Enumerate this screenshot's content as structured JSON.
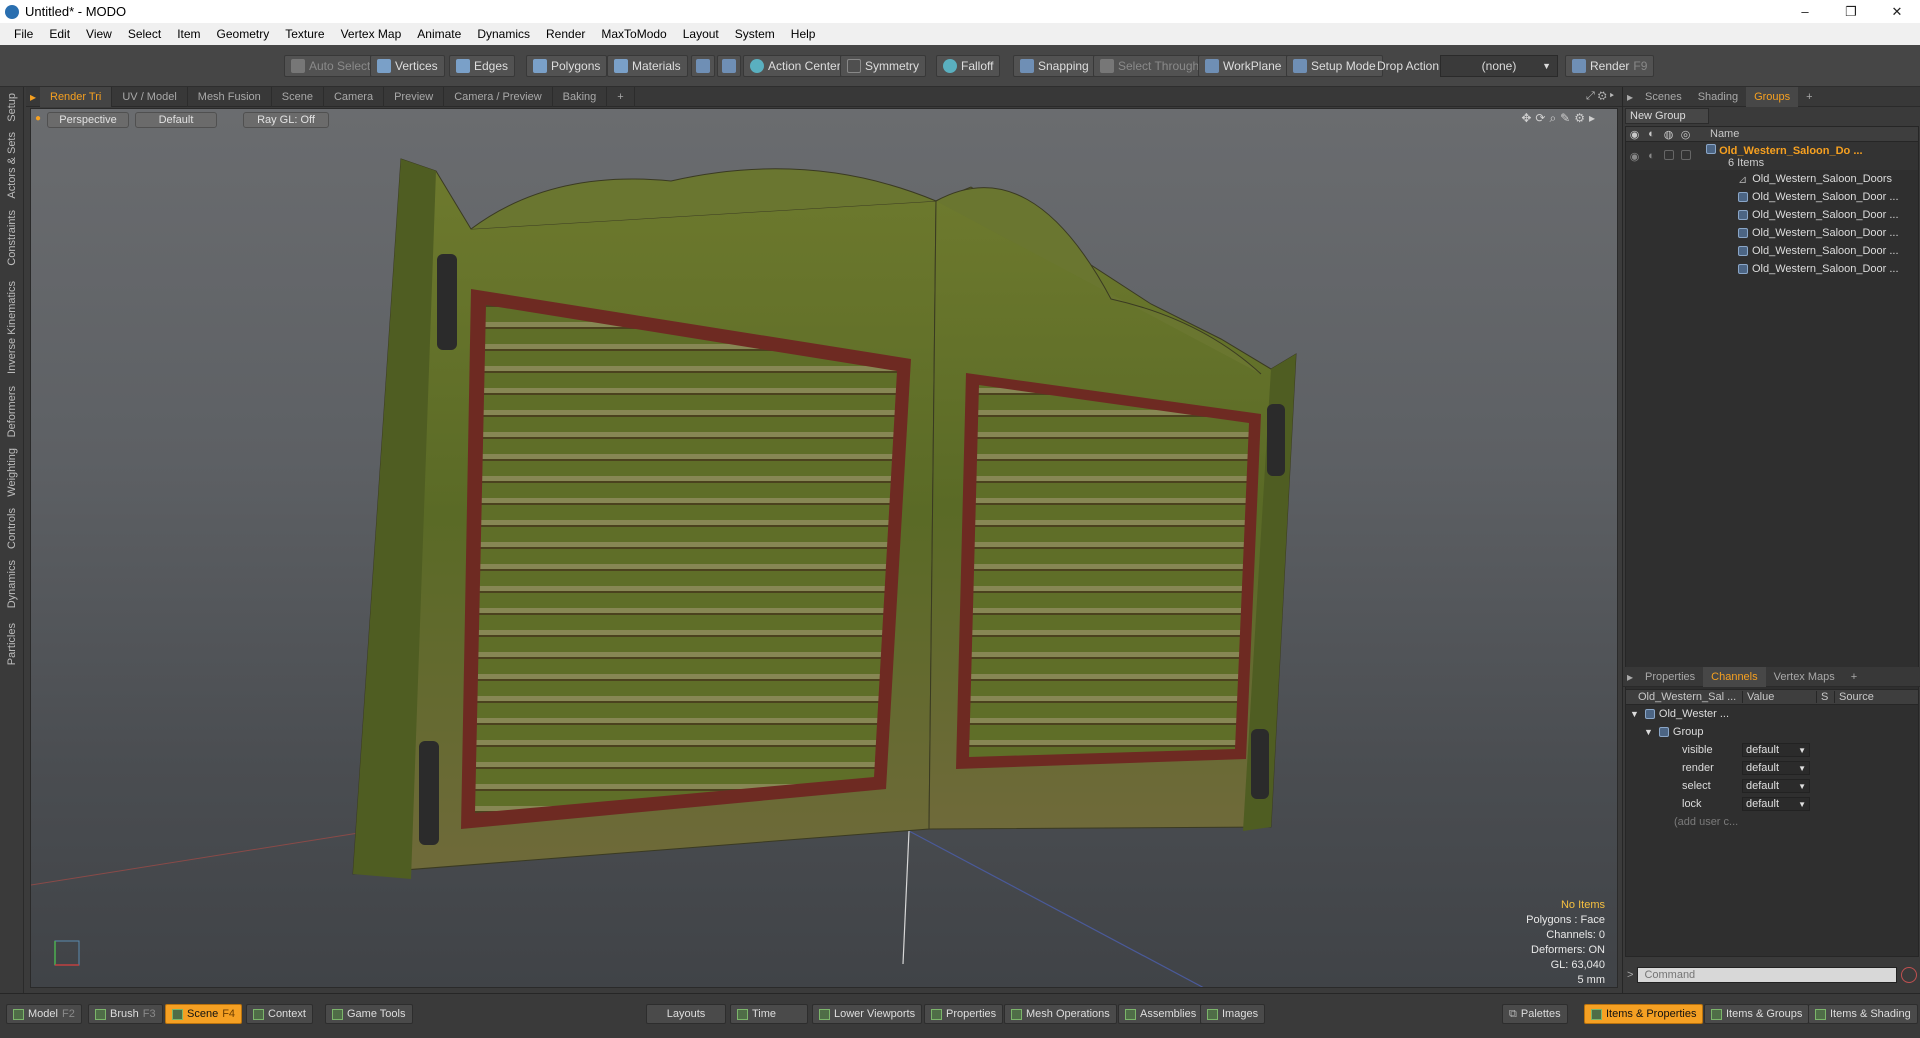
{
  "window": {
    "title": "Untitled* - MODO",
    "minimize": "–",
    "maximize": "❐",
    "close": "✕"
  },
  "menu": [
    "File",
    "Edit",
    "View",
    "Select",
    "Item",
    "Geometry",
    "Texture",
    "Vertex Map",
    "Animate",
    "Dynamics",
    "Render",
    "MaxToModo",
    "Layout",
    "System",
    "Help"
  ],
  "toolbar": {
    "auto_select": "Auto Select",
    "vertices": "Vertices",
    "edges": "Edges",
    "polygons": "Polygons",
    "materials": "Materials",
    "action_center": "Action Center",
    "symmetry": "Symmetry",
    "falloff": "Falloff",
    "snapping": "Snapping",
    "select_through": "Select Through",
    "workplane": "WorkPlane",
    "setup_mode": "Setup Mode",
    "drop_action_label": "Drop Action",
    "drop_action_value": "(none)",
    "render": "Render",
    "render_key": "F9"
  },
  "left_tabs": [
    "Setup",
    "Actors & Sets",
    "Constraints",
    "Inverse Kinematics",
    "Deformers",
    "Weighting",
    "Controls",
    "Dynamics",
    "Particles"
  ],
  "viewport_tabs": [
    "Render Tri",
    "UV / Model",
    "Mesh Fusion",
    "Scene",
    "Camera",
    "Preview",
    "Camera / Preview",
    "Baking",
    "+"
  ],
  "viewport": {
    "view": "Perspective",
    "shading": "Default",
    "raygl": "Ray GL: Off",
    "stats": {
      "items": "No Items",
      "polygons": "Polygons : Face",
      "channels": "Channels: 0",
      "deformers": "Deformers: ON",
      "gl": "GL: 63,040",
      "scale": "5 mm"
    }
  },
  "scene_panel": {
    "tabs": [
      "Scenes",
      "Shading",
      "Groups",
      "+"
    ],
    "new_group": "New Group",
    "name_col": "Name",
    "group_name": "Old_Western_Saloon_Do ...",
    "group_count": "6 Items",
    "children": [
      "Old_Western_Saloon_Doors",
      "Old_Western_Saloon_Door ...",
      "Old_Western_Saloon_Door ...",
      "Old_Western_Saloon_Door ...",
      "Old_Western_Saloon_Door ...",
      "Old_Western_Saloon_Door ..."
    ]
  },
  "channels_panel": {
    "tabs": [
      "Properties",
      "Channels",
      "Vertex Maps",
      "+"
    ],
    "col_name": "Old_Western_Sal ...",
    "col_value": "Value",
    "col_s": "S",
    "col_source": "Source",
    "root": "Old_Wester ...",
    "group": "Group",
    "rows": [
      {
        "name": "visible",
        "value": "default"
      },
      {
        "name": "render",
        "value": "default"
      },
      {
        "name": "select",
        "value": "default"
      },
      {
        "name": "lock",
        "value": "default"
      }
    ],
    "add_user": "(add user c...",
    "command_placeholder": "Command"
  },
  "bottombar": {
    "model": "Model",
    "model_key": "F2",
    "brush": "Brush",
    "brush_key": "F3",
    "scene": "Scene",
    "scene_key": "F4",
    "context": "Context",
    "game_tools": "Game Tools",
    "layouts": "Layouts",
    "time": "Time",
    "lower_viewports": "Lower Viewports",
    "properties": "Properties",
    "mesh_operations": "Mesh Operations",
    "assemblies": "Assemblies",
    "images": "Images",
    "palettes": "Palettes",
    "items_properties": "Items & Properties",
    "items_groups": "Items & Groups",
    "items_shading": "Items & Shading"
  },
  "colors": {
    "accent": "#f5a023",
    "door_green": "#5d6b2a",
    "door_frame": "#6e2a22"
  }
}
